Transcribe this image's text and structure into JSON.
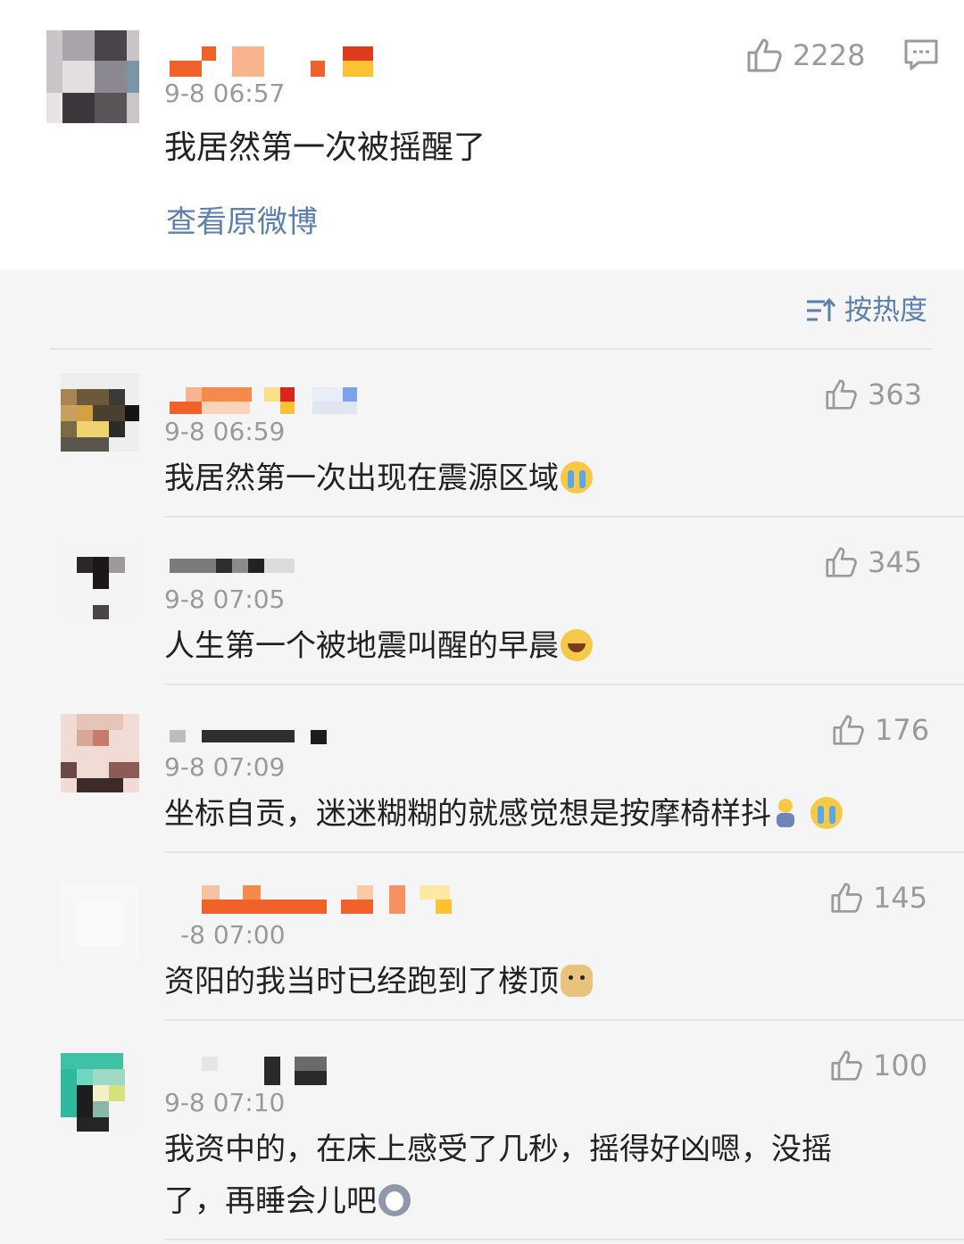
{
  "post": {
    "time": "9-8 06:57",
    "text": "我居然第一次被摇醒了",
    "likes": "2228",
    "view_original": "查看原微博"
  },
  "sort": {
    "label": "按热度"
  },
  "comments": [
    {
      "time": "9-8 06:59",
      "text": "我居然第一次出现在震源区域",
      "likes": "363",
      "emojis": [
        "crying-emoji"
      ]
    },
    {
      "time": "9-8 07:05",
      "text": "人生第一个被地震叫醒的早晨",
      "likes": "345",
      "emojis": [
        "laughing-tears-emoji"
      ]
    },
    {
      "time": "9-8 07:09",
      "text": "坐标自贡，迷迷糊糊的就感觉想是按摩椅样抖",
      "likes": "176",
      "emojis": [
        "kid-emoji",
        "crying-emoji"
      ]
    },
    {
      "time": "-8 07:00",
      "text": "资阳的我当时已经跑到了楼顶",
      "likes": "145",
      "emojis": [
        "doge-emoji"
      ]
    },
    {
      "time": "9-8 07:10",
      "text_line1": "我资中的，在床上感受了几秒，摇得好凶嗯，没摇",
      "text_line2": "了，再睡会儿吧",
      "likes": "100",
      "emojis": [
        "husky-emoji"
      ]
    }
  ],
  "colors": {
    "link": "#5b7fae",
    "meta": "#9a9a9a",
    "text": "#222222",
    "background": "#f5f5f5"
  }
}
